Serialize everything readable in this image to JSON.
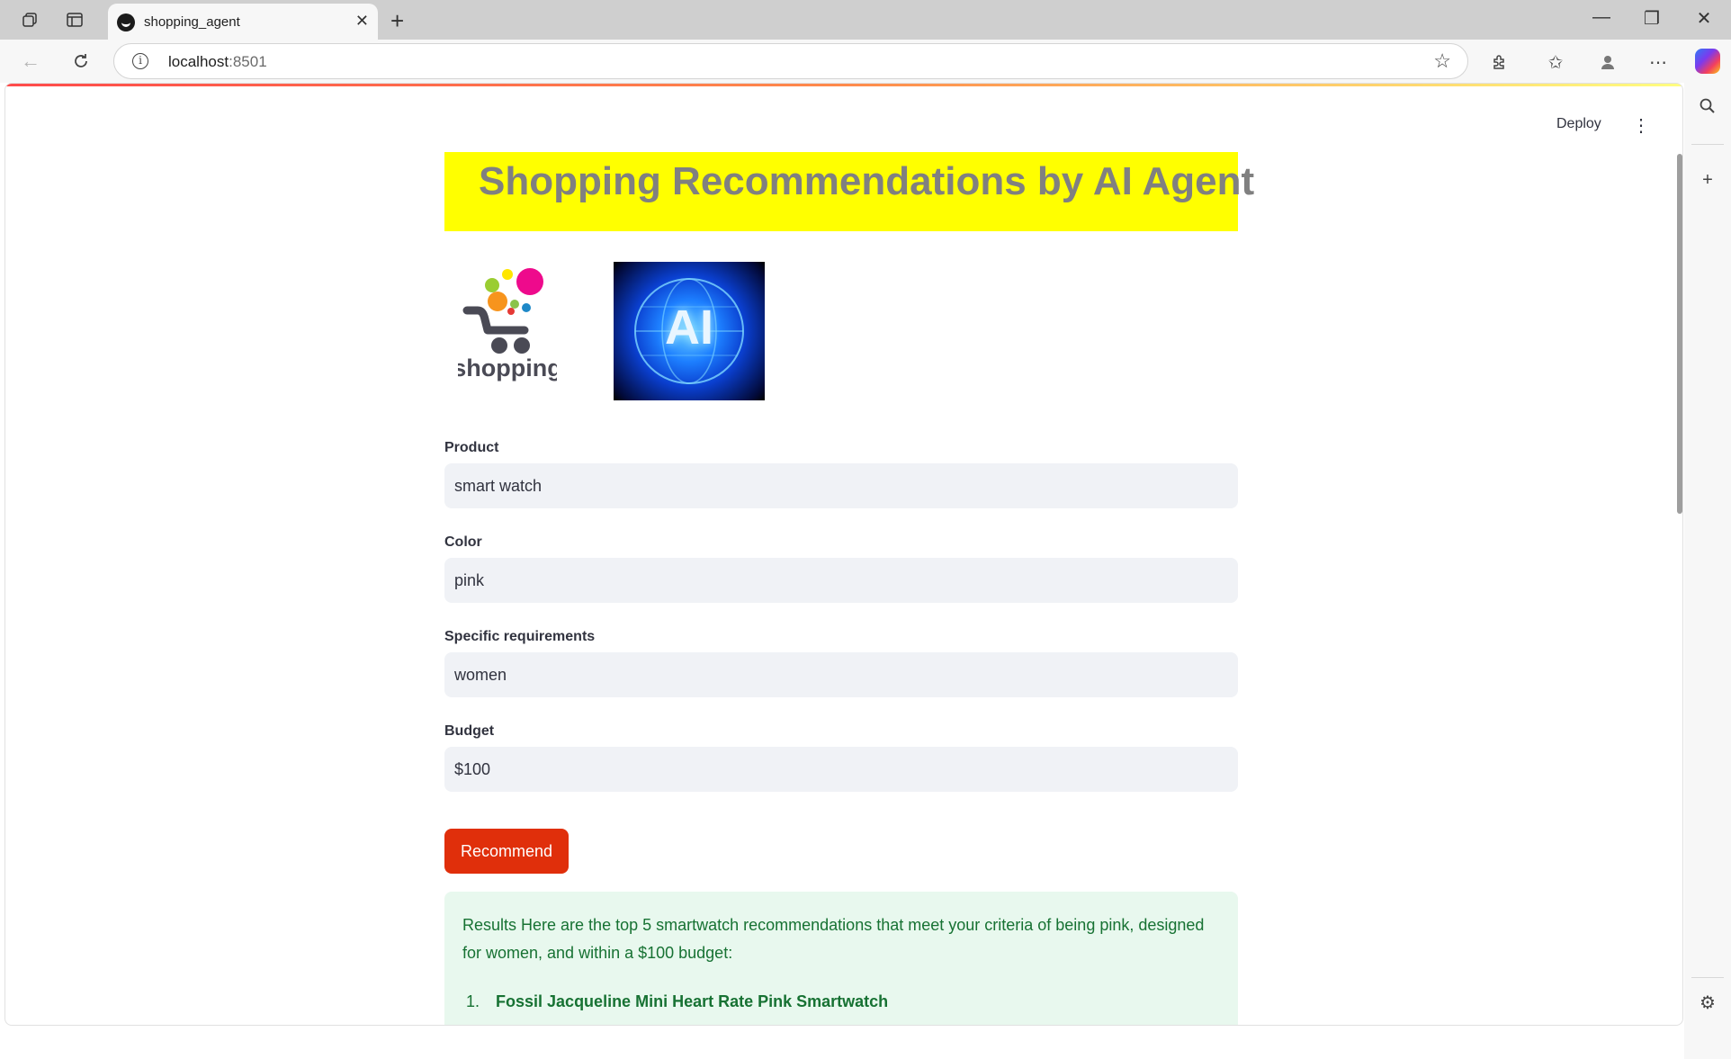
{
  "browser": {
    "tab_title": "shopping_agent",
    "address_host": "localhost",
    "address_port": ":8501"
  },
  "app": {
    "deploy_label": "Deploy",
    "title": "Shopping Recommendations by AI Agent",
    "logo_shop_text": "shopping",
    "logo_ai_text": "AI"
  },
  "form": {
    "product_label": "Product",
    "product_value": "smart watch",
    "color_label": "Color",
    "color_value": "pink",
    "requirements_label": "Specific requirements",
    "requirements_value": "women",
    "budget_label": "Budget",
    "budget_value": "$100",
    "submit_label": "Recommend"
  },
  "results": {
    "intro": "Results Here are the top 5 smartwatch recommendations that meet your criteria of being pink, designed for women, and within a $100 budget:",
    "items": [
      {
        "number": "1.",
        "name": "Fossil Jacqueline Mini Heart Rate Pink Smartwatch"
      }
    ]
  }
}
